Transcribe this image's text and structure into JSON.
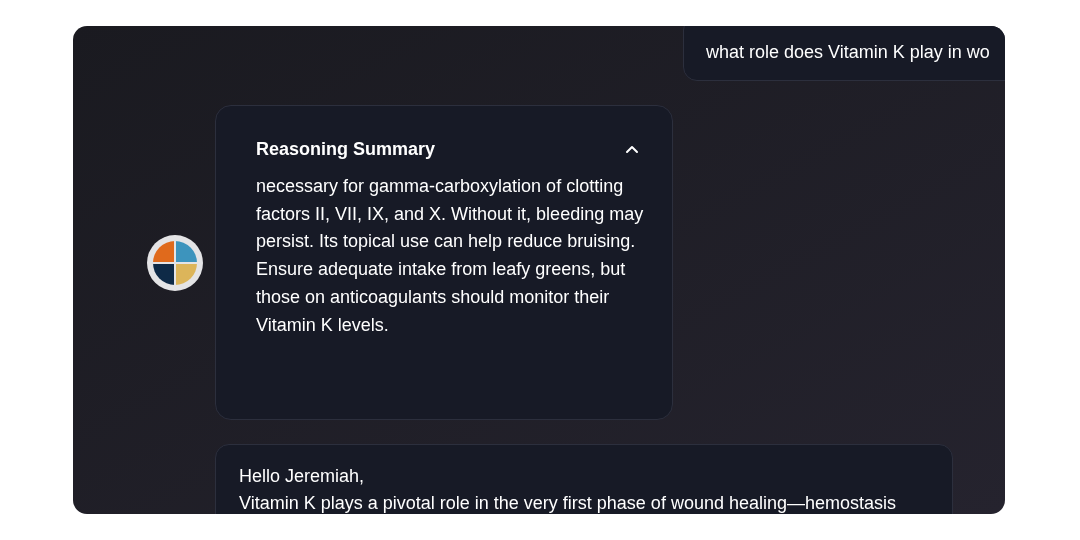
{
  "user_message": {
    "text": "what role does Vitamin K play in wo"
  },
  "reasoning": {
    "title": "Reasoning Summary",
    "expanded": true,
    "text": "necessary for gamma-carboxylation of clotting factors II, VII, IX, and X. Without it, bleeding may persist. Its topical use can help reduce bruising. Ensure adequate intake from leafy greens, but those on anticoagulants should monitor their Vitamin K levels."
  },
  "reply": {
    "lines": [
      "Hello Jeremiah,",
      "Vitamin K plays a pivotal role in the very first phase of wound healing—hemostasis"
    ]
  }
}
